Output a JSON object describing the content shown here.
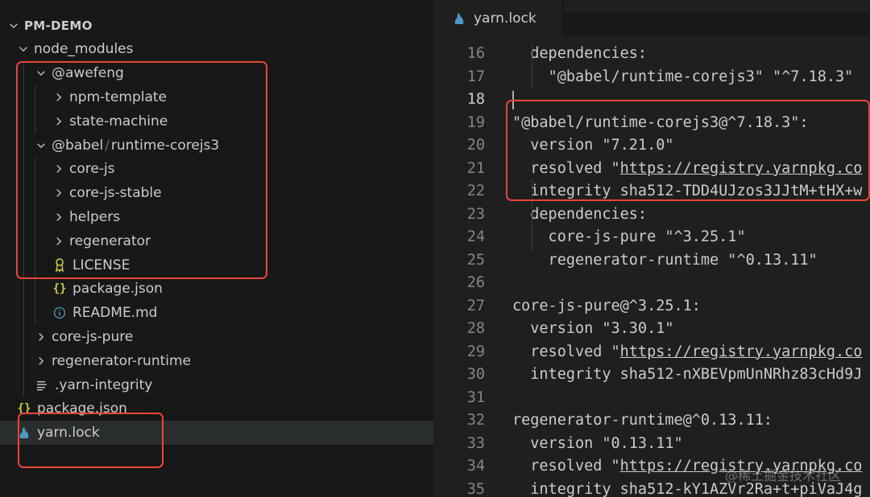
{
  "explorer": {
    "root": "PM-DEMO",
    "items": [
      {
        "label": "node_modules",
        "kind": "folder",
        "open": true,
        "depth": 1
      },
      {
        "label": "@awefeng",
        "kind": "folder",
        "open": true,
        "depth": 2
      },
      {
        "label": "npm-template",
        "kind": "folder",
        "open": false,
        "depth": 3
      },
      {
        "label": "state-machine",
        "kind": "folder",
        "open": false,
        "depth": 3
      },
      {
        "label_scope": "@babel",
        "label_sep": "/",
        "label_name": "runtime-corejs3",
        "kind": "folder",
        "open": true,
        "depth": 2
      },
      {
        "label": "core-js",
        "kind": "folder",
        "open": false,
        "depth": 3
      },
      {
        "label": "core-js-stable",
        "kind": "folder",
        "open": false,
        "depth": 3
      },
      {
        "label": "helpers",
        "kind": "folder",
        "open": false,
        "depth": 3
      },
      {
        "label": "regenerator",
        "kind": "folder",
        "open": false,
        "depth": 3
      },
      {
        "label": "LICENSE",
        "kind": "license",
        "depth": 3
      },
      {
        "label": "package.json",
        "kind": "json",
        "depth": 3
      },
      {
        "label": "README.md",
        "kind": "info",
        "depth": 3
      },
      {
        "label": "core-js-pure",
        "kind": "folder",
        "open": false,
        "depth": 2
      },
      {
        "label": "regenerator-runtime",
        "kind": "folder",
        "open": false,
        "depth": 2
      },
      {
        "label": ".yarn-integrity",
        "kind": "text",
        "depth": 2
      },
      {
        "label": "package.json",
        "kind": "json",
        "depth": 1
      },
      {
        "label": "yarn.lock",
        "kind": "yarn",
        "depth": 1,
        "selected": true
      }
    ]
  },
  "editor": {
    "tab_label": "yarn.lock",
    "lines": [
      {
        "n": "16",
        "text": "  dependencies:"
      },
      {
        "n": "17",
        "text": "    \"@babel/runtime-corejs3\" \"^7.18.3\""
      },
      {
        "n": "18",
        "text": "",
        "current": true
      },
      {
        "n": "19",
        "text": "\"@babel/runtime-corejs3@^7.18.3\":"
      },
      {
        "n": "20",
        "text": "  version \"7.21.0\""
      },
      {
        "n": "21",
        "pre": "  resolved \"",
        "url": "https://registry.yarnpkg.co"
      },
      {
        "n": "22",
        "text": "  integrity sha512-TDD4UJzos3JJtM+tHX+w"
      },
      {
        "n": "23",
        "text": "  dependencies:"
      },
      {
        "n": "24",
        "text": "    core-js-pure \"^3.25.1\""
      },
      {
        "n": "25",
        "text": "    regenerator-runtime \"^0.13.11\""
      },
      {
        "n": "26",
        "text": ""
      },
      {
        "n": "27",
        "text": "core-js-pure@^3.25.1:"
      },
      {
        "n": "28",
        "text": "  version \"3.30.1\""
      },
      {
        "n": "29",
        "pre": "  resolved \"",
        "url": "https://registry.yarnpkg.co"
      },
      {
        "n": "30",
        "text": "  integrity sha512-nXBEVpmUnNRhz83cHd9J"
      },
      {
        "n": "31",
        "text": ""
      },
      {
        "n": "32",
        "text": "regenerator-runtime@^0.13.11:"
      },
      {
        "n": "33",
        "text": "  version \"0.13.11\""
      },
      {
        "n": "34",
        "pre": "  resolved \"",
        "url": "https://registry.yarnpkg.co"
      },
      {
        "n": "35",
        "text": "  integrity sha512-kY1AZVr2Ra+t+piVaJ4g"
      }
    ]
  },
  "watermark": "@稀土掘金技术社区",
  "colors": {
    "highlight": "#e8453c",
    "folder_chevron": "#c5c5c5",
    "json_icon": "#cbcb41",
    "info_icon": "#519aba",
    "yarn_icon": "#4d98c4",
    "license_icon": "#cbcb41"
  }
}
